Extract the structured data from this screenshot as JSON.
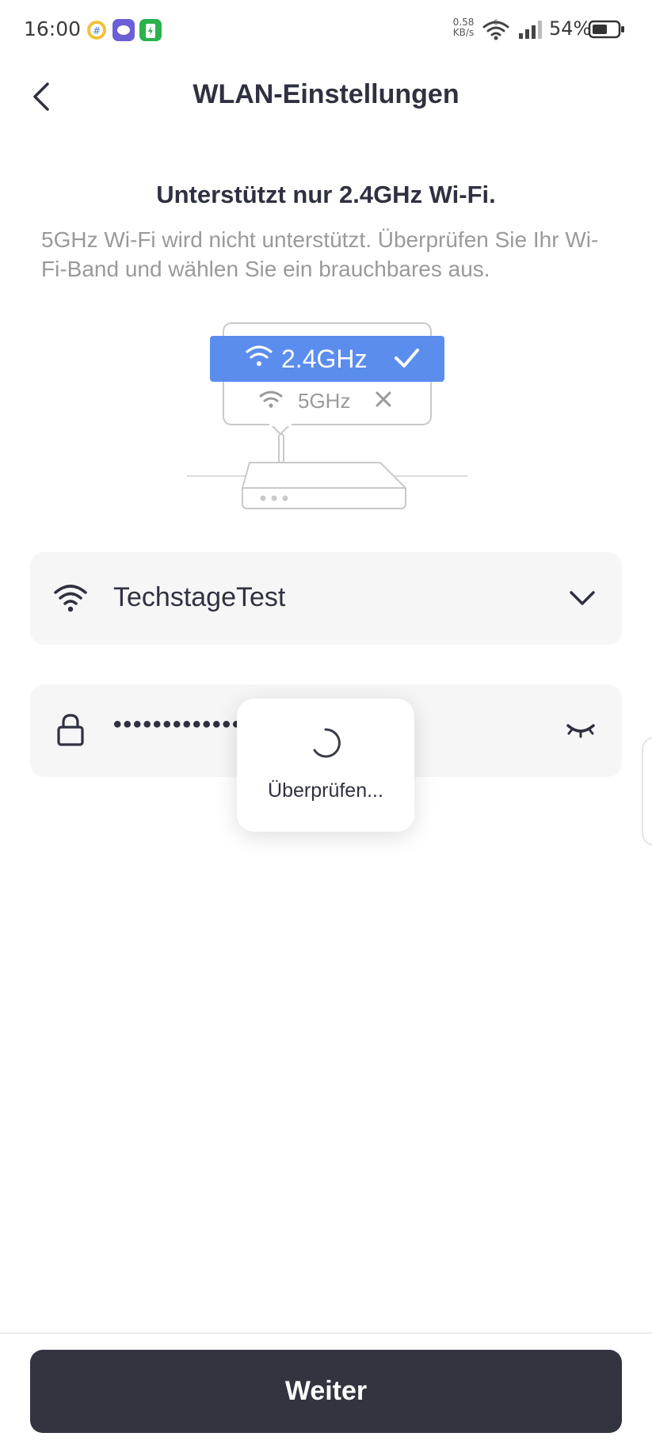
{
  "status_bar": {
    "time": "16:00",
    "net_speed_value": "0.58",
    "net_speed_unit": "KB/s",
    "wifi_badge": "6",
    "battery_percent": "54%"
  },
  "header": {
    "title": "WLAN-Einstellungen"
  },
  "info": {
    "headline": "Unterstützt nur 2.4GHz Wi-Fi.",
    "description": "5GHz Wi-Fi wird nicht unterstützt. Überprüfen Sie Ihr Wi-Fi-Band und wählen Sie ein brauchbares aus."
  },
  "illustration": {
    "band_supported": "2.4GHz",
    "band_unsupported": "5GHz",
    "accent_color": "#5b8def"
  },
  "ssid_field": {
    "value": "TechstageTest",
    "icon": "wifi-icon"
  },
  "password_field": {
    "masked_value": "•••••••••••••",
    "icon": "lock-icon",
    "toggle_icon": "eye-closed-icon"
  },
  "loading": {
    "text": "Überprüfen..."
  },
  "footer": {
    "next_label": "Weiter",
    "button_color": "#32353f"
  }
}
